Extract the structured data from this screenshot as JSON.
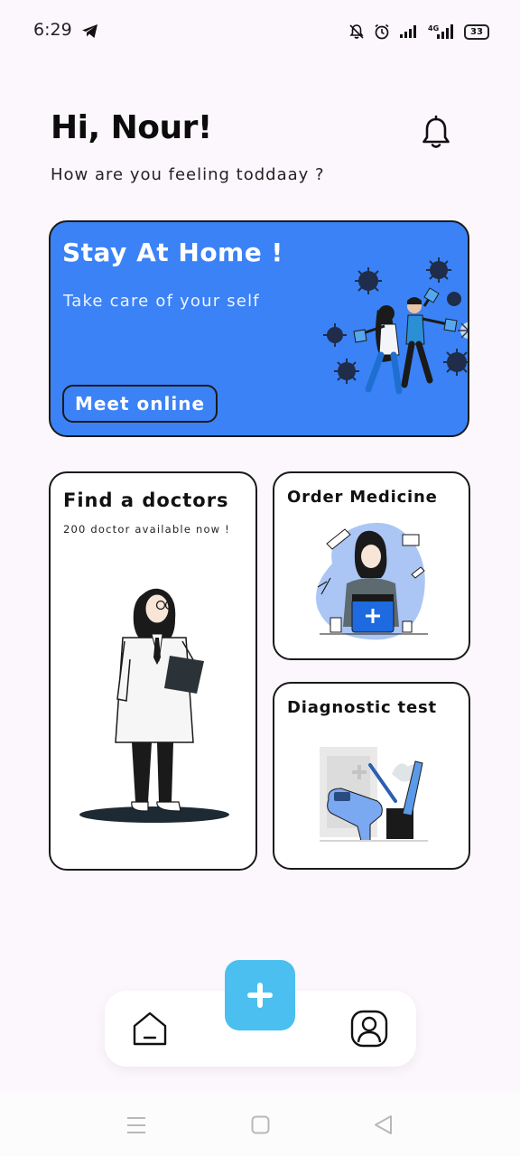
{
  "status_bar": {
    "time": "6:29",
    "battery": "33"
  },
  "header": {
    "greeting": "Hi, Nour!",
    "subtitle": "How are you feeling toddaay ?"
  },
  "banner": {
    "title": "Stay At Home !",
    "subtitle": "Take care of your self",
    "button": "Meet online"
  },
  "cards": {
    "doctor": {
      "title": "Find a doctors",
      "subtitle": "200 doctor available now !"
    },
    "medicine": {
      "title": "Order Medicine"
    },
    "diagnostic": {
      "title": "Diagnostic test"
    }
  },
  "colors": {
    "accent": "#3b82f6",
    "fab": "#4bbfef",
    "background": "#fcf7fc"
  },
  "icons": {
    "status": [
      "telegram-icon",
      "mute-icon",
      "alarm-icon",
      "signal-icon",
      "4g-signal-icon",
      "battery-icon"
    ],
    "header": "bell-icon",
    "nav": [
      "home-icon",
      "plus-icon",
      "profile-icon"
    ],
    "system_nav": [
      "menu-icon",
      "square-icon",
      "back-icon"
    ]
  }
}
